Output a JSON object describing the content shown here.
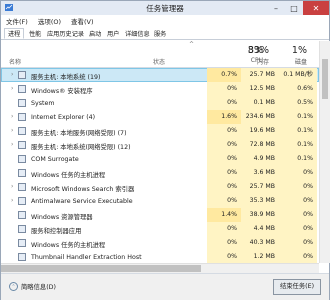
{
  "window": {
    "title": "任务管理器",
    "controls": [
      "–",
      "□",
      "✕"
    ]
  },
  "menu": [
    "文件(F)",
    "选项(O)",
    "查看(V)"
  ],
  "tabs": [
    "进程",
    "性能",
    "应用历史记录",
    "启动",
    "用户",
    "详细信息",
    "服务"
  ],
  "header": {
    "name": "名称",
    "status": "状态",
    "cpu_pct": "8%",
    "cpu": "CPU",
    "mem_pct": "33%",
    "mem": "内存",
    "disk_pct": "1%",
    "disk": "磁盘",
    "sort_indicator": "^"
  },
  "rows": [
    {
      "expand": "›",
      "name": "服务主机: 本地系统 (19)",
      "cpu": "0.7%",
      "mem": "25.7 MB",
      "disk": "0.1 MB/秒",
      "selected": true
    },
    {
      "expand": "›",
      "name": "Windows® 安装程序",
      "cpu": "0%",
      "mem": "12.5 MB",
      "disk": "0.6%",
      "selected": false
    },
    {
      "expand": "",
      "name": "System",
      "cpu": "0%",
      "mem": "0.1 MB",
      "disk": "0.5%",
      "selected": false
    },
    {
      "expand": "›",
      "name": "Internet Explorer (4)",
      "cpu": "1.6%",
      "mem": "234.6 MB",
      "disk": "0.1%",
      "selected": false
    },
    {
      "expand": "›",
      "name": "服务主机: 本地服务(网络受限) (7)",
      "cpu": "0%",
      "mem": "19.6 MB",
      "disk": "0.1%",
      "selected": false
    },
    {
      "expand": "›",
      "name": "服务主机: 本地系统(网络受限) (12)",
      "cpu": "0%",
      "mem": "72.8 MB",
      "disk": "0.1%",
      "selected": false
    },
    {
      "expand": "",
      "name": "COM Surrogate",
      "cpu": "0%",
      "mem": "4.9 MB",
      "disk": "0.1%",
      "selected": false
    },
    {
      "expand": "",
      "name": "Windows 任务的主机进程",
      "cpu": "0%",
      "mem": "3.6 MB",
      "disk": "0%",
      "selected": false
    },
    {
      "expand": "›",
      "name": "Microsoft Windows Search 索引器",
      "cpu": "0%",
      "mem": "25.7 MB",
      "disk": "0%",
      "selected": false
    },
    {
      "expand": "›",
      "name": "Antimalware Service Executable",
      "cpu": "0%",
      "mem": "35.3 MB",
      "disk": "0%",
      "selected": false
    },
    {
      "expand": "",
      "name": "Windows 资源管理器",
      "cpu": "1.4%",
      "mem": "38.9 MB",
      "disk": "0%",
      "selected": false
    },
    {
      "expand": "",
      "name": "服务和控制器应用",
      "cpu": "0%",
      "mem": "4.4 MB",
      "disk": "0%",
      "selected": false
    },
    {
      "expand": "",
      "name": "Windows 任务的主机进程",
      "cpu": "0%",
      "mem": "40.3 MB",
      "disk": "0%",
      "selected": false
    },
    {
      "expand": "",
      "name": "Thumbnail Handler Extraction Host",
      "cpu": "0%",
      "mem": "1.2 MB",
      "disk": "0%",
      "selected": false
    }
  ],
  "footer": {
    "brief": "简略信息(D)",
    "end_task": "结束任务(E)"
  }
}
